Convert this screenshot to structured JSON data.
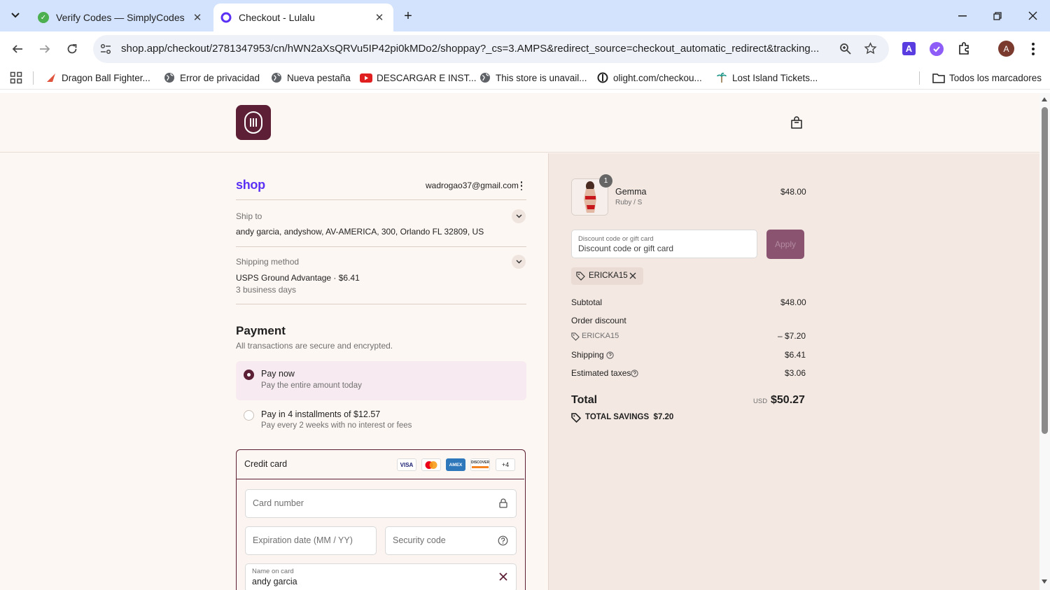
{
  "browser": {
    "tabs": [
      {
        "title": "Verify Codes — SimplyCodes",
        "active": false
      },
      {
        "title": "Checkout - Lulalu",
        "active": true
      }
    ],
    "url": "shop.app/checkout/2781347953/cn/hWN2aXsQRVu5IP42pi0kMDo2/shoppay?_cs=3.AMPS&redirect_source=checkout_automatic_redirect&tracking...",
    "profile_initial": "A",
    "bookmarks": [
      {
        "label": "Dragon Ball Fighter..."
      },
      {
        "label": "Error de privacidad"
      },
      {
        "label": "Nueva pestaña"
      },
      {
        "label": "DESCARGAR E INST..."
      },
      {
        "label": "This store is unavail..."
      },
      {
        "label": "olight.com/checkou..."
      },
      {
        "label": "Lost Island Tickets..."
      }
    ],
    "all_bookmarks_label": "Todos los marcadores"
  },
  "checkout": {
    "shop_logo": "shop",
    "email": "wadrogao37@gmail.com",
    "ship_to": {
      "label": "Ship to",
      "value": "andy garcia, andyshow, AV-AMERICA, 300, Orlando FL 32809, US"
    },
    "shipping_method": {
      "label": "Shipping method",
      "value": "USPS Ground Advantage · $6.41",
      "detail": "3 business days"
    },
    "payment": {
      "title": "Payment",
      "subtitle": "All transactions are secure and encrypted.",
      "options": [
        {
          "label": "Pay now",
          "sub": "Pay the entire amount today",
          "selected": true
        },
        {
          "label": "Pay in 4 installments of $12.57",
          "sub": "Pay every 2 weeks with no interest or fees",
          "selected": false
        }
      ],
      "credit_card_label": "Credit card",
      "card_brands": [
        "VISA",
        "mastercard",
        "AMEX",
        "DISCOVER"
      ],
      "more_brands": "+4",
      "card_number_placeholder": "Card number",
      "expiration_placeholder": "Expiration date (MM / YY)",
      "security_placeholder": "Security code",
      "name_label": "Name on card",
      "name_value": "andy garcia"
    }
  },
  "summary": {
    "item": {
      "name": "Gemma",
      "variant": "Ruby / S",
      "price": "$48.00",
      "qty": "1"
    },
    "discount": {
      "label": "Discount code or gift card",
      "placeholder": "Discount code or gift card",
      "apply": "Apply"
    },
    "applied_code": "ERICKA15",
    "subtotal": {
      "label": "Subtotal",
      "value": "$48.00"
    },
    "order_discount": {
      "label": "Order discount",
      "code": "ERICKA15",
      "value": "– $7.20"
    },
    "shipping": {
      "label": "Shipping",
      "value": "$6.41"
    },
    "taxes": {
      "label": "Estimated taxes",
      "value": "$3.06"
    },
    "total": {
      "label": "Total",
      "currency": "USD",
      "value": "$50.27"
    },
    "savings": "TOTAL SAVINGS  $7.20"
  },
  "colors": {
    "brand": "#5c1f35",
    "shop_purple": "#5a31f4",
    "apply_btn": "#8a5470",
    "page_bg": "#fdf7f3",
    "summary_bg": "#f3e8e2"
  }
}
